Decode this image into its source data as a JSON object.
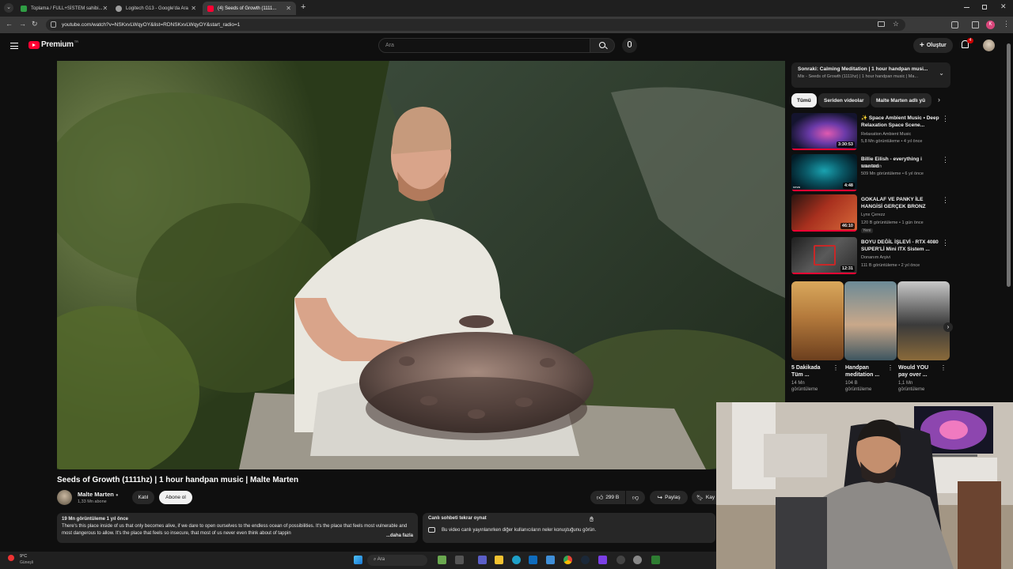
{
  "browser": {
    "tabs": [
      {
        "title": "Toplama / FULL+SİSTEM sahibi...",
        "fav": "#2f9e44",
        "close": "✕"
      },
      {
        "title": "Logitech G13 - Google'da Ara",
        "fav": "#9e9e9e",
        "close": "✕"
      },
      {
        "title": "(4) Seeds of Growth (1111...",
        "fav": "#ff0033",
        "close": "✕"
      }
    ],
    "url": "youtube.com/watch?v=NSKxvLWqyOY&list=RDNSKxvLWqyOY&start_radio=1",
    "new_tab": "+"
  },
  "youtube": {
    "logo": "Premium",
    "logo_sup": "TR",
    "search_placeholder": "Ara",
    "create_label": "Oluştur",
    "notif_count": "4"
  },
  "video": {
    "title": "Seeds of Growth (1111hz) | 1 hour handpan music | Malte Marten",
    "channel": "Malte Marten",
    "subscribers": "1,33 Mn abone",
    "join_label": "Katıl",
    "subscribe_label": "Abone ol",
    "likes": "299 B",
    "share_label": "Paylaş",
    "save_label": "Kay"
  },
  "description": {
    "meta": "19 Mn görüntüleme  1 yıl önce",
    "text": "There's this place inside of us that only becomes alive, if we dare to open ourselves to the endless ocean of possibilities. It's the place that feels most vulnerable and most dangerous to allow. It's the place that feels so insecure, that most of us never even think about of tappin",
    "more": "...daha fazla"
  },
  "chat": {
    "title": "Canlı sohbeti tekrar oynat",
    "text": "Bu video canlı yayınlanırken diğer kullanıcıların neler konuştuğunu görün."
  },
  "upnext": {
    "title": "Sonraki: Calming Meditation | 1 hour handpan musi...",
    "subtitle": "Mix - Seeds of Growth (1111hz) | 1 hour handpan music | Ma..."
  },
  "chips": [
    "Tümü",
    "Seriden videolar",
    "Malte Marten adlı yü"
  ],
  "recommendations": [
    {
      "title": "✨ Space Ambient Music • Deep Relaxation Space Scene...",
      "channel": "Relaxation Ambient Music",
      "meta": "5,8 Mn görüntüleme • 4 yıl önce",
      "duration": "3:30:53",
      "colors": [
        "#14142e",
        "#6a3aa8",
        "#e05ab0"
      ]
    },
    {
      "title": "Billie Eilish - everything i wanted",
      "channel": "Billie Eilish",
      "meta": "509 Mn görüntüleme • 6 yıl önce",
      "duration": "4:48",
      "colors": [
        "#031a24",
        "#0a5866",
        "#1aa2b0"
      ]
    },
    {
      "title": "GOKALAF VE PANKY İLE HANGİSİ GERÇEK BRONZ",
      "channel": "Lynx Çerezz",
      "meta": "120 B görüntüleme • 1 gün önce",
      "badge": "Yeni",
      "duration": "46:10",
      "colors": [
        "#2a1410",
        "#a8301e",
        "#d86a3a"
      ]
    },
    {
      "title": "BOYU DEĞİL İŞLEVİ - RTX 4080 SUPER'Lİ Mini ITX Sistem ...",
      "channel": "Donanım Arşivi",
      "meta": "111 B görüntüleme • 2 yıl önce",
      "duration": "12:31",
      "colors": [
        "#1e1e1e",
        "#5a5a5a",
        "#c82828"
      ]
    }
  ],
  "shorts": [
    {
      "title": "5 Dakikada Tüm ...",
      "views": "14 Mn",
      "views2": "görüntüleme",
      "colors": [
        "#b47a3c",
        "#6c3f1e",
        "#d9a85c"
      ]
    },
    {
      "title": "Handpan meditation ...",
      "views": "104 B",
      "views2": "görüntüleme",
      "colors": [
        "#6c8a96",
        "#c9a88a",
        "#3d5560"
      ]
    },
    {
      "title": "Would YOU pay over ...",
      "views": "1,1 Mn",
      "views2": "görüntüleme",
      "colors": [
        "#3a3a3a",
        "#c9c9c9",
        "#8a6a3a"
      ]
    }
  ],
  "taskbar": {
    "weather": "9°C",
    "weather_sub": "Güneşli",
    "search": "Ara"
  }
}
